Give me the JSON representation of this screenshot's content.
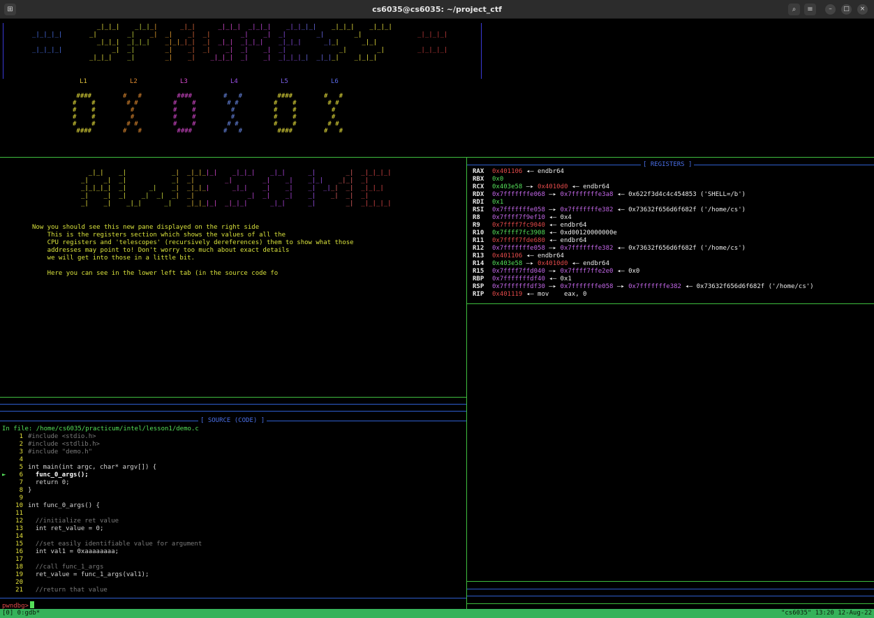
{
  "window": {
    "title": "cs6035@cs6035: ~/project_ctf",
    "new_tab_icon": "new-tab-icon",
    "search_icon": "search-icon",
    "menu_icon": "hamburger-menu-icon",
    "minimize_icon": "minimize-icon",
    "maximize_icon": "maximize-icon",
    "close_icon": "close-icon"
  },
  "banner": {
    "art_left": "_|_|_|_|\n\n_|_|_|_|",
    "art_title": "  _|_|_|    _|_|_|      _|_|      _|_|_|  _|_|_|    _|_|_|_|    _|_|_|    _|_|_|\n_|        _|    _|  _|    _|  _|        _|    _|  _|        _|        _|    \n  _|_|_|  _|_|_|    _|_|_|_|  _|  _|_|  _|_|_|    _|_|_|      _|_|      _|_|  \n      _|  _|        _|    _|  _|    _|  _|    _|  _|              _|        _|\n_|_|_|    _|        _|    _|    _|_|_|  _|    _|  _|_|_|_|  _|_|_|    _|_|_|  ",
    "art_right": "_|_|_|_|\n\n_|_|_|_|",
    "levels": [
      "L1",
      "L2",
      "L3",
      "L4",
      "L5",
      "L6"
    ],
    "digit_zero": " #### \n#    #\n#    #\n#    #\n#    #\n #### ",
    "digit_x": "#   #\n # # \n  #  \n  #  \n # # \n#   #"
  },
  "lesson": {
    "art": "  _|_|    _|            _|  _|_|_|_|    _|_|_|    _|_|      _|        _|  _|_|_|_|\n_|    _|  _|            _|  _|        _|        _|    _|    _|_|    _|_|  _|      \n_|_|_|_|  _|      _|    _|  _|_|_|      _|_|    _|    _|    _|  _|_|  _|  _|_|_|  \n_|    _|  _|    _|  _|  _|  _|              _|  _|    _|    _|    _|  _|  _|      \n_|    _|    _|_|      _|    _|_|_|_|  _|_|_|      _|_|      _|        _|  _|_|_|_|",
    "message": "Now you should see this new pane displayed on the right side\n    This is the registers section which shows the values of all the\n    CPU registers and 'telescopes' (recursively dereferences) them to show what those\n    addresses may point to! Don't worry too much about exact details\n    we will get into those in a little bit.\n\n    Here you can see in the lower left tab (in the source code fo"
  },
  "registers": {
    "header": "[ REGISTERS ]",
    "rows": [
      {
        "name": "RAX",
        "value": "0x401106",
        "value_color": "red",
        "chain": " ◂— endbr64"
      },
      {
        "name": "RBX",
        "value": "0x0",
        "value_color": "green",
        "chain": ""
      },
      {
        "name": "RCX",
        "value": "0x403e58",
        "value_color": "green",
        "chain_parts": [
          {
            "t": " —▸ ",
            "c": "white"
          },
          {
            "t": "0x4010d0",
            "c": "red"
          },
          {
            "t": " ◂— endbr64",
            "c": "white"
          }
        ]
      },
      {
        "name": "RDX",
        "value": "0x7fffffffe068",
        "value_color": "purple",
        "chain_parts": [
          {
            "t": " —▸ ",
            "c": "white"
          },
          {
            "t": "0x7fffffffe3a8",
            "c": "purple"
          },
          {
            "t": " ◂— 0x622f3d4c4c454853 ('SHELL=/b')",
            "c": "white"
          }
        ]
      },
      {
        "name": "RDI",
        "value": "0x1",
        "value_color": "green",
        "chain": ""
      },
      {
        "name": "RSI",
        "value": "0x7fffffffe058",
        "value_color": "purple",
        "chain_parts": [
          {
            "t": " —▸ ",
            "c": "white"
          },
          {
            "t": "0x7fffffffe382",
            "c": "purple"
          },
          {
            "t": " ◂— 0x73632f656d6f682f ('/home/cs')",
            "c": "white"
          }
        ]
      },
      {
        "name": "R8",
        "value": "0x7ffff7f9ef10",
        "value_color": "purple",
        "chain": " ◂— 0x4"
      },
      {
        "name": "R9",
        "value": "0x7ffff7fc9040",
        "value_color": "red",
        "chain": " ◂— endbr64"
      },
      {
        "name": "R10",
        "value": "0x7ffff7fc3908",
        "value_color": "green",
        "chain": " ◂— 0xd00120000000e"
      },
      {
        "name": "R11",
        "value": "0x7ffff7fde680",
        "value_color": "red",
        "chain": " ◂— endbr64"
      },
      {
        "name": "R12",
        "value": "0x7fffffffe058",
        "value_color": "purple",
        "chain_parts": [
          {
            "t": " —▸ ",
            "c": "white"
          },
          {
            "t": "0x7fffffffe382",
            "c": "purple"
          },
          {
            "t": " ◂— 0x73632f656d6f682f ('/home/cs')",
            "c": "white"
          }
        ]
      },
      {
        "name": "R13",
        "value": "0x401106",
        "value_color": "red",
        "chain": " ◂— endbr64"
      },
      {
        "name": "R14",
        "value": "0x403e58",
        "value_color": "green",
        "chain_parts": [
          {
            "t": " —▸ ",
            "c": "white"
          },
          {
            "t": "0x4010d0",
            "c": "red"
          },
          {
            "t": " ◂— endbr64",
            "c": "white"
          }
        ]
      },
      {
        "name": "R15",
        "value": "0x7ffff7ffd040",
        "value_color": "purple",
        "chain_parts": [
          {
            "t": " —▸ ",
            "c": "white"
          },
          {
            "t": "0x7ffff7ffe2e0",
            "c": "purple"
          },
          {
            "t": " ◂— 0x0",
            "c": "white"
          }
        ]
      },
      {
        "name": "RBP",
        "value": "0x7fffffffdf40",
        "value_color": "purple",
        "chain": " ◂— 0x1"
      },
      {
        "name": "RSP",
        "value": "0x7fffffffdf30",
        "value_color": "purple",
        "chain_parts": [
          {
            "t": " —▸ ",
            "c": "white"
          },
          {
            "t": "0x7fffffffe058",
            "c": "purple"
          },
          {
            "t": " —▸ ",
            "c": "white"
          },
          {
            "t": "0x7fffffffe382",
            "c": "purple"
          },
          {
            "t": " ◂— 0x73632f656d6f682f ('/home/cs')",
            "c": "white"
          }
        ]
      },
      {
        "name": "RIP",
        "value": "0x401119",
        "value_color": "red",
        "chain": " ◂— mov    eax, 0"
      }
    ]
  },
  "source": {
    "header": "[ SOURCE (CODE) ]",
    "file_line": "In file: /home/cs6035/practicum/intel/lesson1/demo.c",
    "current_marker": "►",
    "lines": [
      {
        "num": "1",
        "code": "#include <stdio.h>",
        "kind": "cmt"
      },
      {
        "num": "2",
        "code": "#include <stdlib.h>",
        "kind": "cmt"
      },
      {
        "num": "3",
        "code": "#include \"demo.h\"",
        "kind": "cmt"
      },
      {
        "num": "4",
        "code": "",
        "kind": "code"
      },
      {
        "num": "5",
        "code": "int main(int argc, char* argv[]) {",
        "kind": "code"
      },
      {
        "num": "6",
        "code": "  func_0_args();",
        "kind": "cur"
      },
      {
        "num": "7",
        "code": "  return 0;",
        "kind": "code"
      },
      {
        "num": "8",
        "code": "}",
        "kind": "code"
      },
      {
        "num": "9",
        "code": "",
        "kind": "code"
      },
      {
        "num": "10",
        "code": "int func_0_args() {",
        "kind": "code"
      },
      {
        "num": "11",
        "code": "",
        "kind": "code"
      },
      {
        "num": "12",
        "code": "  //initialize ret value",
        "kind": "cmt"
      },
      {
        "num": "13",
        "code": "  int ret_value = 0;",
        "kind": "code"
      },
      {
        "num": "14",
        "code": "",
        "kind": "code"
      },
      {
        "num": "15",
        "code": "  //set easily identifiable value for argument",
        "kind": "cmt"
      },
      {
        "num": "16",
        "code": "  int val1 = 0xaaaaaaaa;",
        "kind": "code"
      },
      {
        "num": "17",
        "code": "",
        "kind": "code"
      },
      {
        "num": "18",
        "code": "  //call func_1_args",
        "kind": "cmt"
      },
      {
        "num": "19",
        "code": "  ret_value = func_1_args(val1);",
        "kind": "code"
      },
      {
        "num": "20",
        "code": "",
        "kind": "code"
      },
      {
        "num": "21",
        "code": "  //return that value",
        "kind": "cmt"
      }
    ]
  },
  "prompt": {
    "text": "pwndbg>"
  },
  "statusbar": {
    "left": "[0] 0:gdb*",
    "right": "\"cs6035\" 13:20 12-Aug-22"
  }
}
